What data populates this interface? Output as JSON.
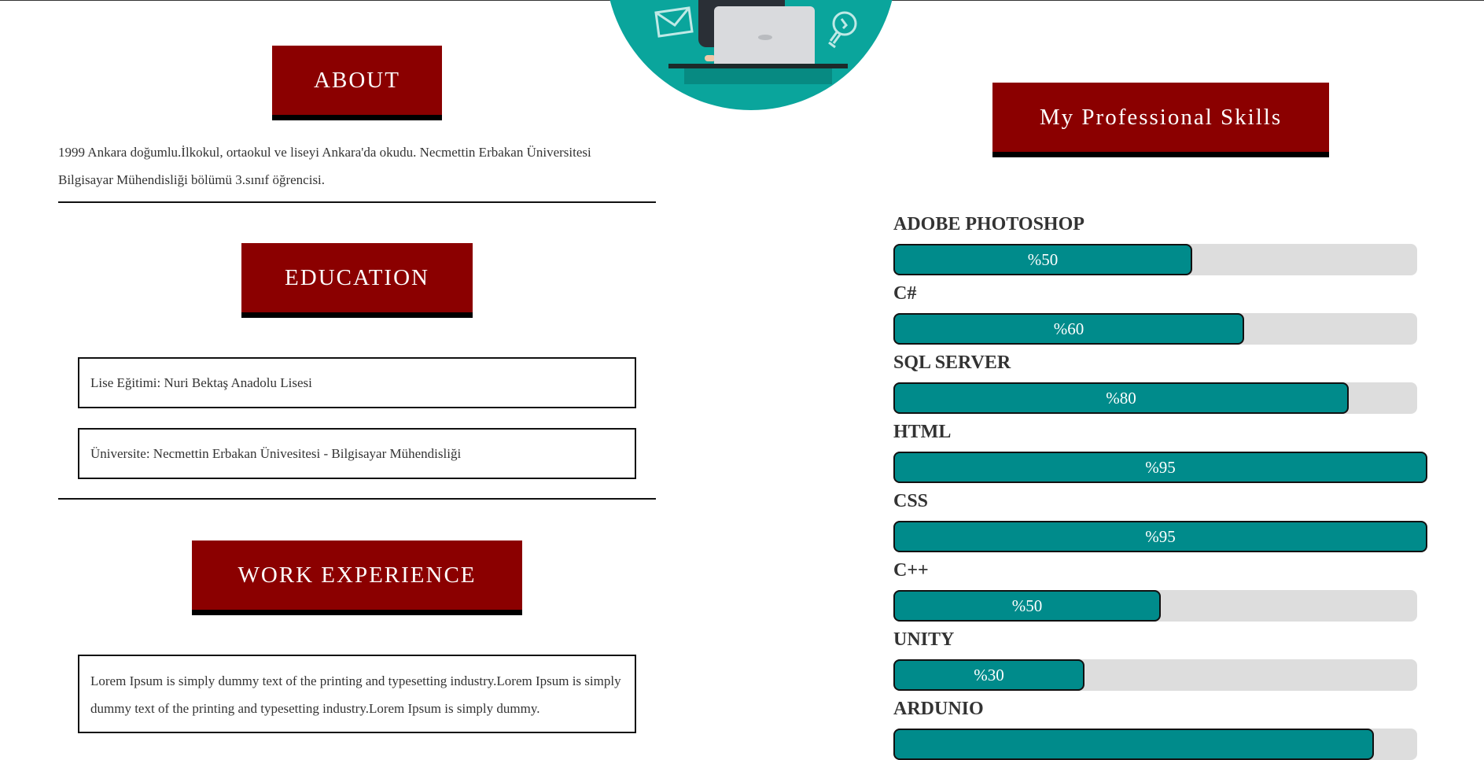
{
  "sections": {
    "about": {
      "title": "ABOUT",
      "text": "1999 Ankara doğumlu.İlkokul, ortaokul ve liseyi Ankara'da okudu. Necmettin Erbakan Üniversitesi Bilgisayar Mühendisliği bölümü 3.sınıf öğrencisi."
    },
    "education": {
      "title": "EDUCATION",
      "items": [
        "Lise Eğitimi: Nuri Bektaş Anadolu Lisesi",
        "Üniversite: Necmettin Erbakan Ünivesitesi - Bilgisayar Mühendisliği"
      ]
    },
    "work": {
      "title": "WORK EXPERIENCE",
      "text": "Lorem Ipsum is simply dummy text of the printing and typesetting industry.Lorem Ipsum is simply dummy text of the printing and typesetting industry.Lorem Ipsum is simply dummy."
    }
  },
  "skills": {
    "title": "My Professional Skills",
    "items": [
      {
        "name": "ADOBE PHOTOSHOP",
        "label": "%50",
        "fraction": 0.57
      },
      {
        "name": "C#",
        "label": "%60",
        "fraction": 0.67
      },
      {
        "name": "SQL SERVER",
        "label": "%80",
        "fraction": 0.87
      },
      {
        "name": "HTML",
        "label": "%95",
        "fraction": 1.02
      },
      {
        "name": "CSS",
        "label": "%95",
        "fraction": 1.02
      },
      {
        "name": "C++",
        "label": "%50",
        "fraction": 0.51
      },
      {
        "name": "UNITY",
        "label": "%30",
        "fraction": 0.365
      },
      {
        "name": "ARDUNIO",
        "label": "",
        "fraction": 0.917
      }
    ]
  },
  "colors": {
    "heading_bg": "#8b0000",
    "bar_fill": "#008b8b",
    "bar_track": "#dddddd",
    "hero_bg": "#0aa59c"
  },
  "icons": [
    "mail-icon",
    "lightbulb-icon"
  ]
}
